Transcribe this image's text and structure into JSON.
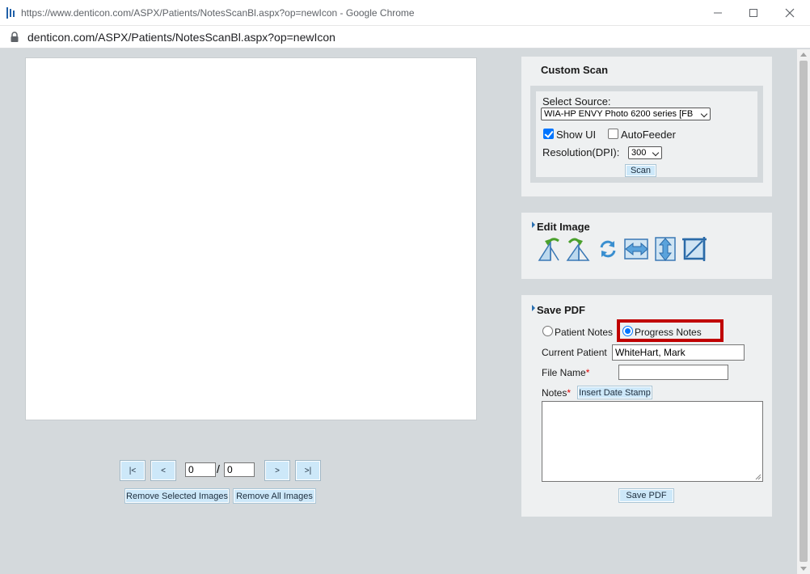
{
  "browser": {
    "title": "https://www.denticon.com/ASPX/Patients/NotesScanBl.aspx?op=newIcon - Google Chrome",
    "url": "denticon.com/ASPX/Patients/NotesScanBl.aspx?op=newIcon"
  },
  "pager": {
    "first_label": "|<",
    "prev_label": "<",
    "current_page": "0",
    "separator": "/",
    "total_pages": "0",
    "next_label": ">",
    "last_label": ">|",
    "remove_selected_label": "Remove Selected Images",
    "remove_all_label": "Remove All Images"
  },
  "custom_scan": {
    "title": "Custom Scan",
    "select_source_label": "Select Source:",
    "source_value": "WIA-HP ENVY Photo 6200 series [FB",
    "show_ui_label": "Show UI",
    "show_ui_checked": true,
    "autofeeder_label": "AutoFeeder",
    "autofeeder_checked": false,
    "resolution_label": "Resolution(DPI):",
    "resolution_value": "300",
    "scan_label": "Scan"
  },
  "edit_image": {
    "title": "Edit Image",
    "tools": [
      "rotate-left-icon",
      "rotate-right-icon",
      "rotate-180-icon",
      "flip-horizontal-icon",
      "flip-vertical-icon",
      "crop-icon"
    ]
  },
  "save_pdf": {
    "title": "Save PDF",
    "patient_notes_label": "Patient Notes",
    "progress_notes_label": "Progress Notes",
    "selected_note_type": "Progress Notes",
    "current_patient_label": "Current Patient",
    "current_patient_value": "WhiteHart, Mark",
    "file_name_label": "File Name",
    "file_name_value": "",
    "notes_label": "Notes",
    "required_marker": "*",
    "insert_date_stamp_label": "Insert Date Stamp",
    "notes_value": "",
    "save_pdf_label": "Save PDF"
  },
  "colors": {
    "button_bg": "#cde8f9",
    "panel_bg": "#eef0f1",
    "page_bg": "#d4d9dc",
    "highlight": "#c00000",
    "accent": "#0075ff"
  }
}
